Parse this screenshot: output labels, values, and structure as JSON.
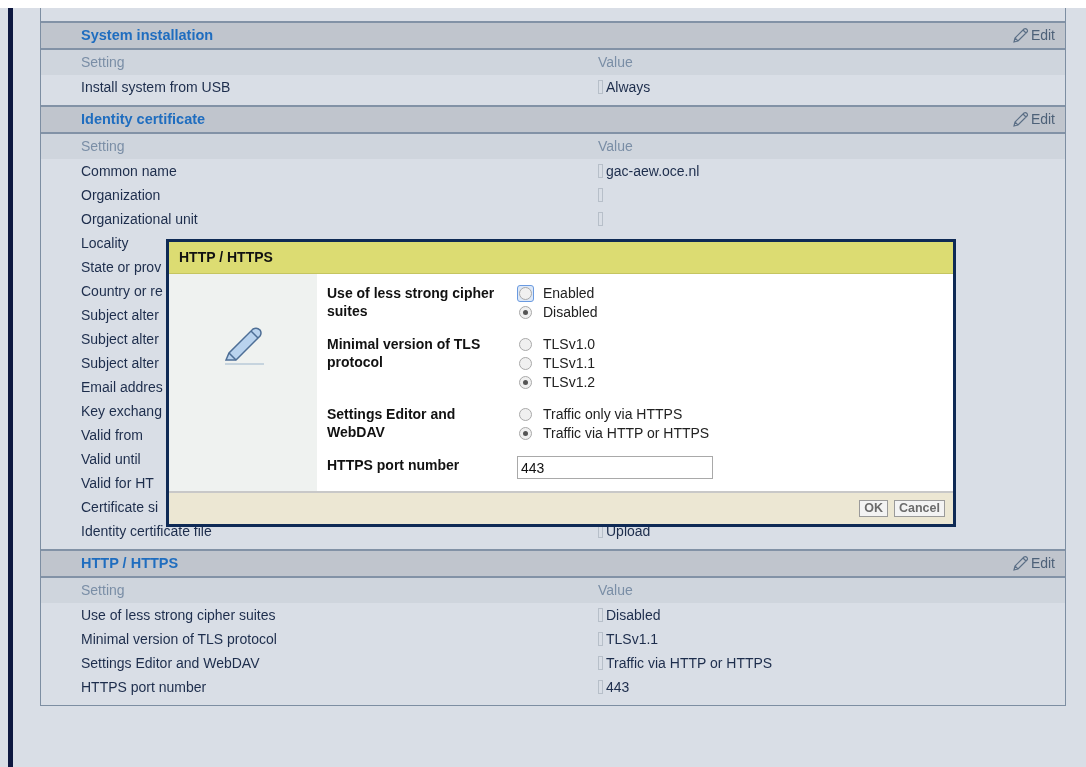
{
  "sections": [
    {
      "title": "System installation",
      "edit": "Edit",
      "columns": [
        "Setting",
        "Value"
      ],
      "rows": [
        {
          "setting": "Install system from USB",
          "marker": true,
          "value": "Always"
        }
      ]
    },
    {
      "title": "Identity certificate",
      "edit": "Edit",
      "columns": [
        "Setting",
        "Value"
      ],
      "rows": [
        {
          "setting": "Common name",
          "marker": true,
          "value": "gac-aew.oce.nl"
        },
        {
          "setting": "Organization",
          "marker": true
        },
        {
          "setting": "Organizational unit",
          "marker": true
        },
        {
          "setting": "Locality",
          "marker": false
        },
        {
          "setting": "State or prov",
          "marker": false
        },
        {
          "setting": "Country or re",
          "marker": false
        },
        {
          "setting": "Subject alter",
          "marker": false
        },
        {
          "setting": "Subject alter",
          "marker": false
        },
        {
          "setting": "Subject alter",
          "marker": false
        },
        {
          "setting": "Email addres",
          "marker": false
        },
        {
          "setting": "Key exchang",
          "marker": false
        },
        {
          "setting": "Valid from",
          "marker": false
        },
        {
          "setting": "Valid until",
          "marker": false
        },
        {
          "setting": "Valid for HT",
          "marker": false
        },
        {
          "setting": "Certificate si",
          "marker": false
        },
        {
          "setting": "Identity certificate file",
          "marker": true,
          "value": "Upload"
        }
      ]
    },
    {
      "title": "HTTP / HTTPS",
      "edit": "Edit",
      "columns": [
        "Setting",
        "Value"
      ],
      "rows": [
        {
          "setting": "Use of less strong cipher suites",
          "marker": true,
          "value": "Disabled"
        },
        {
          "setting": "Minimal version of TLS protocol",
          "marker": true,
          "value": "TLSv1.1"
        },
        {
          "setting": "Settings Editor and WebDAV",
          "marker": true,
          "value": "Traffic via HTTP or HTTPS"
        },
        {
          "setting": "HTTPS port number",
          "marker": true,
          "value": "443"
        }
      ]
    }
  ],
  "dialog": {
    "title": "HTTP / HTTPS",
    "fields": [
      {
        "kind": "radio",
        "label": "Use of less strong cipher suites",
        "options": [
          {
            "label": "Enabled",
            "selected": false,
            "focused": true
          },
          {
            "label": "Disabled",
            "selected": true,
            "focused": false
          }
        ]
      },
      {
        "kind": "radio",
        "label": "Minimal version of TLS protocol",
        "options": [
          {
            "label": "TLSv1.0",
            "selected": false,
            "focused": false
          },
          {
            "label": "TLSv1.1",
            "selected": false,
            "focused": false
          },
          {
            "label": "TLSv1.2",
            "selected": true,
            "focused": false
          }
        ]
      },
      {
        "kind": "radio",
        "label": "Settings Editor and WebDAV",
        "options": [
          {
            "label": "Traffic only via HTTPS",
            "selected": false,
            "focused": false
          },
          {
            "label": "Traffic via HTTP or HTTPS",
            "selected": true,
            "focused": false
          }
        ]
      },
      {
        "kind": "text",
        "label": "HTTPS port number",
        "value": "443"
      }
    ],
    "buttons": [
      "OK",
      "Cancel"
    ]
  }
}
